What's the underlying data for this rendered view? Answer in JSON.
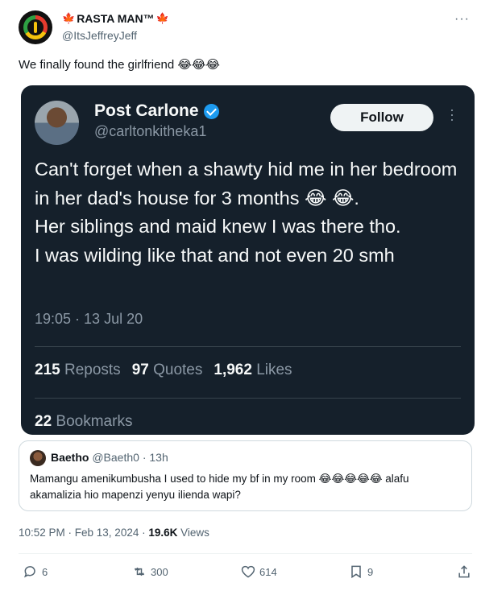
{
  "author": {
    "display_name": "RASTA MAN™",
    "flag_emoji_left": "🍁",
    "flag_emoji_right": "🍁",
    "handle": "@ItsJeffreyJeff"
  },
  "tweet_text": "We finally found the girlfriend",
  "tweet_emojis": "😂😂😂",
  "embedded": {
    "name": "Post Carlone",
    "handle": "@carltonkitheka1",
    "follow_label": "Follow",
    "body": "Can't forget when a shawty hid me in her bedroom in her dad's house for 3 months 😂 😂.\nHer siblings and maid knew I was there tho.\nI was wilding like that and not even 20 smh",
    "timestamp": "19:05 · 13 Jul 20",
    "reposts_count": "215",
    "reposts_label": "Reposts",
    "quotes_count": "97",
    "quotes_label": "Quotes",
    "likes_count": "1,962",
    "likes_label": "Likes",
    "bookmarks_count": "22",
    "bookmarks_label": "Bookmarks"
  },
  "quote": {
    "name": "Baetho",
    "handle": "@Baeth0",
    "age": "· 13h",
    "text": "Mamangu amenikumbusha I used to hide my bf in my room 😂😂😂😂😂 alafu akamalizia hio mapenzi yenyu ilienda wapi?"
  },
  "meta": {
    "time": "10:52 PM · Feb 13, 2024 ·",
    "views_count": "19.6K",
    "views_label": "Views"
  },
  "actions": {
    "replies": "6",
    "reposts": "300",
    "likes": "614",
    "bookmarks": "9"
  },
  "colors": {
    "card_bg": "#15202b",
    "verified": "#1d9bf0",
    "muted": "#536471"
  }
}
